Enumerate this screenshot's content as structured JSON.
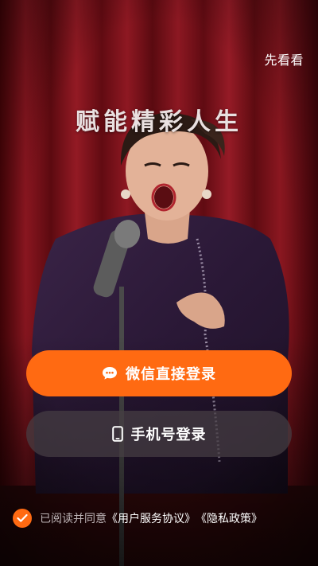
{
  "header": {
    "skip_label": "先看看"
  },
  "hero": {
    "slogan": "赋能精彩人生"
  },
  "login": {
    "wechat_label": "微信直接登录",
    "phone_label": "手机号登录"
  },
  "agreement": {
    "prefix": "已阅读并同意",
    "terms_link": "《用户服务协议》",
    "privacy_link": "《隐私政策》",
    "checked": true
  },
  "icons": {
    "wechat": "chat-bubble-icon",
    "phone": "mobile-phone-icon",
    "check": "check-icon"
  },
  "colors": {
    "accent": "#ff6a12",
    "secondary_button": "#463e44",
    "curtain": "#7a0f18"
  }
}
